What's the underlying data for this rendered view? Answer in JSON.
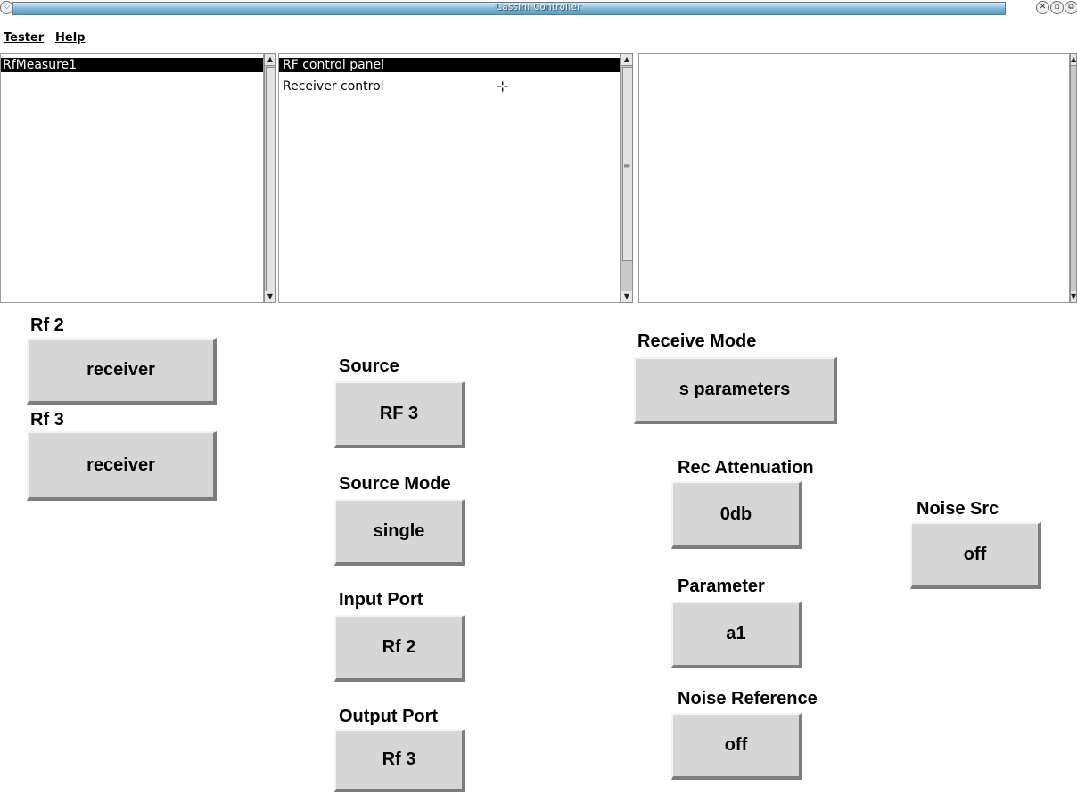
{
  "window": {
    "title": "Cassini Controller"
  },
  "menubar": {
    "items": [
      {
        "label": "Tester"
      },
      {
        "label": "Help"
      }
    ]
  },
  "lists": {
    "left": {
      "items": [
        "RfMeasure1"
      ],
      "selected": 0
    },
    "middle": {
      "items": [
        "RF control panel",
        "Receiver control"
      ],
      "selected": 0
    },
    "right": {
      "items": []
    }
  },
  "panel": {
    "rf2": {
      "label": "Rf 2",
      "value": "receiver"
    },
    "rf3": {
      "label": "Rf 3",
      "value": "receiver"
    },
    "source": {
      "label": "Source",
      "value": "RF 3"
    },
    "source_mode": {
      "label": "Source Mode",
      "value": "single"
    },
    "input_port": {
      "label": "Input Port",
      "value": "Rf 2"
    },
    "output_port": {
      "label": "Output Port",
      "value": "Rf 3"
    },
    "receive_mode": {
      "label": "Receive Mode",
      "value": "s parameters"
    },
    "rec_attenuation": {
      "label": "Rec Attenuation",
      "value": "0db"
    },
    "parameter": {
      "label": "Parameter",
      "value": "a1"
    },
    "noise_reference": {
      "label": "Noise Reference",
      "value": "off"
    },
    "noise_src": {
      "label": "Noise Src",
      "value": "off"
    }
  }
}
